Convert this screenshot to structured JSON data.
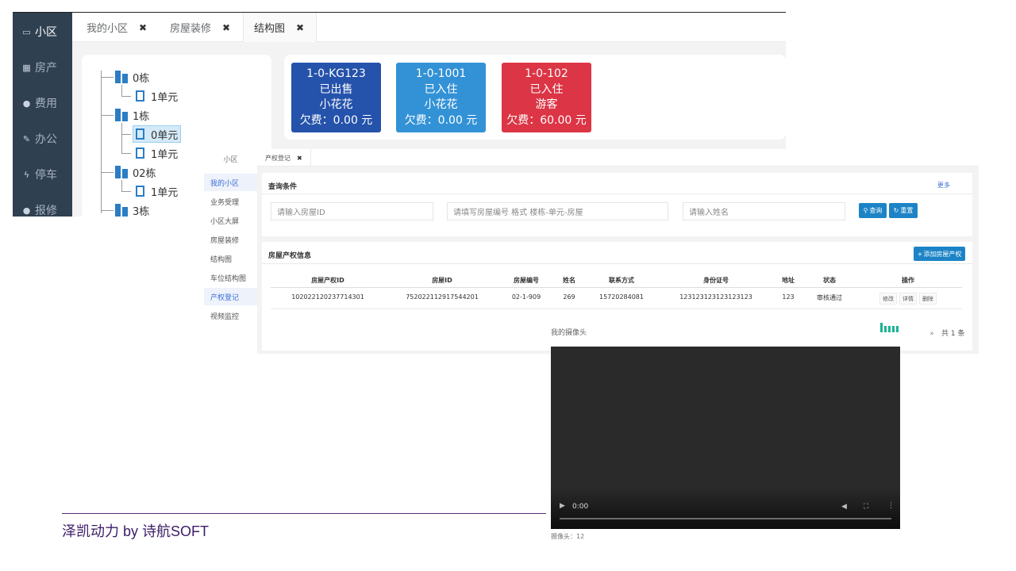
{
  "shot1": {
    "sidebar": [
      {
        "icon": "laptop-icon",
        "glyph": "▭",
        "label": "小区"
      },
      {
        "icon": "grid-icon",
        "glyph": "▦",
        "label": "房产"
      },
      {
        "icon": "globe-icon",
        "glyph": "●",
        "label": "费用"
      },
      {
        "icon": "edit-icon",
        "glyph": "✎",
        "label": "办公"
      },
      {
        "icon": "bolt-icon",
        "glyph": "ϟ",
        "label": "停车"
      },
      {
        "icon": "globe-icon",
        "glyph": "●",
        "label": "报修"
      }
    ],
    "tabs": [
      {
        "label": "我的小区",
        "close": "✖"
      },
      {
        "label": "房屋装修",
        "close": "✖"
      },
      {
        "label": "结构图",
        "close": "✖"
      }
    ],
    "tree": {
      "b0": "0栋",
      "b0_u1": "1单元",
      "b1": "1栋",
      "b1_u0": "0单元",
      "b1_u1": "1单元",
      "b02": "02栋",
      "b02_u1": "1单元",
      "b3": "3栋"
    },
    "rooms": [
      {
        "code": "1-0-KG123",
        "status": "已出售",
        "owner": "小花花",
        "arrears": "欠费：0.00 元",
        "color": "#2553ab"
      },
      {
        "code": "1-0-1001",
        "status": "已入住",
        "owner": "小花花",
        "arrears": "欠费：0.00 元",
        "color": "#3392d6"
      },
      {
        "code": "1-0-102",
        "status": "已入住",
        "owner": "游客",
        "arrears": "欠费：60.00 元",
        "color": "#dc3545"
      }
    ]
  },
  "shot2": {
    "sidebar_title": "小区",
    "sidebar": [
      "我的小区",
      "业务受理",
      "小区大屏",
      "房屋装修",
      "结构图",
      "车位结构图",
      "产权登记",
      "视频监控"
    ],
    "tab": {
      "label": "产权登记",
      "close": "✖"
    },
    "query": {
      "title": "查询条件",
      "more": "更多",
      "placeholder_property_id": "请输入房屋ID",
      "placeholder_house_code": "请填写房屋编号 格式 楼栋-单元-房屋",
      "placeholder_name": "请输入姓名",
      "search_label": "查询",
      "reset_label": "重置"
    },
    "info": {
      "title": "房屋产权信息",
      "add_label": "添加房屋产权",
      "columns": [
        "房屋产权ID",
        "房屋ID",
        "房屋编号",
        "姓名",
        "联系方式",
        "身份证号",
        "地址",
        "状态",
        "操作"
      ],
      "row": [
        "102022120237714301",
        "752022112917544201",
        "02-1-909",
        "269",
        "15720284081",
        "123123123123123123",
        "123",
        "审核通过"
      ],
      "actions": [
        "修改",
        "详情",
        "删除"
      ],
      "total": "共 1 条"
    }
  },
  "video": {
    "title": "我的摄像头",
    "time": "0:00",
    "camera_count": "摄像头：12"
  },
  "footer": {
    "text": "泽凯动力 by 诗航SOFT"
  }
}
